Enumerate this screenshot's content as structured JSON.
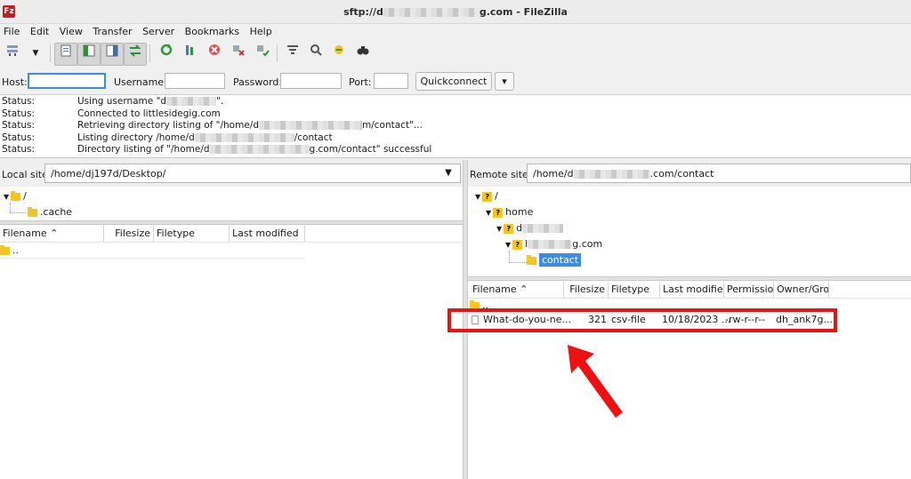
{
  "window": {
    "title_prefix": "sftp://d",
    "title_suffix": "g.com - FileZilla",
    "app_icon": "Fz"
  },
  "menu": [
    "File",
    "Edit",
    "View",
    "Transfer",
    "Server",
    "Bookmarks",
    "Help"
  ],
  "toolbar": {
    "icons": [
      "site-manager-icon",
      "dropdown-arrow-icon",
      "toggle-log-icon",
      "toggle-local-tree-icon",
      "toggle-remote-tree-icon",
      "toggle-queue-icon",
      "refresh-icon",
      "process-queue-icon",
      "cancel-icon",
      "disconnect-icon",
      "reconnect-icon",
      "filter-icon",
      "search-remote-icon",
      "sync-browse-icon",
      "find-files-icon"
    ]
  },
  "quickconnect": {
    "host_label": "Host:",
    "host_value": "",
    "username_label": "Username:",
    "username_value": "",
    "password_label": "Password:",
    "password_value": "",
    "port_label": "Port:",
    "port_value": "",
    "button_label": "Quickconnect",
    "dropdown_glyph": "▾"
  },
  "log": [
    {
      "key": "Status:",
      "pre": "Using username \"d",
      "post": "\"."
    },
    {
      "key": "Status:",
      "pre": "Connected to littlesidegig.com",
      "post": ""
    },
    {
      "key": "Status:",
      "pre": "Retrieving directory listing of \"/home/d",
      "post": "m/contact\"..."
    },
    {
      "key": "Status:",
      "pre": "Listing directory /home/d",
      "post": "/contact"
    },
    {
      "key": "Status:",
      "pre": "Directory listing of \"/home/d",
      "post": "g.com/contact\" successful"
    }
  ],
  "local": {
    "site_label": "Local site:",
    "path": "/home/dj197d/Desktop/",
    "tree": {
      "root": "/",
      "child": ".cache"
    },
    "columns": [
      "Filename",
      "Filesize",
      "Filetype",
      "Last modified"
    ],
    "sort_glyph": "⌃",
    "rows": [
      {
        "name": ".."
      }
    ]
  },
  "remote": {
    "site_label": "Remote site:",
    "path_prefix": "/home/d",
    "path_suffix": ".com/contact",
    "tree": {
      "root": "/",
      "home": "home",
      "user_prefix": "d",
      "domain_prefix": "l",
      "domain_suffix": "g.com",
      "selected": "contact"
    },
    "columns": [
      "Filename",
      "Filesize",
      "Filetype",
      "Last modified",
      "Permission",
      "Owner/Grou"
    ],
    "sort_glyph": "⌃",
    "rows": [
      {
        "name": "..",
        "size": "",
        "type": "",
        "modified": "",
        "perm": "",
        "owner": ""
      },
      {
        "name": "What-do-you-ne...",
        "size": "321",
        "type": "csv-file",
        "modified": "10/18/2023 ...",
        "perm": "-rw-r--r--",
        "owner": "dh_ank7g..."
      }
    ]
  },
  "annotation": {
    "highlight_color": "#ee1111",
    "arrow_color": "#ee1111"
  },
  "colors": {
    "folder": "#f4c521",
    "selection": "#3d8be8"
  }
}
